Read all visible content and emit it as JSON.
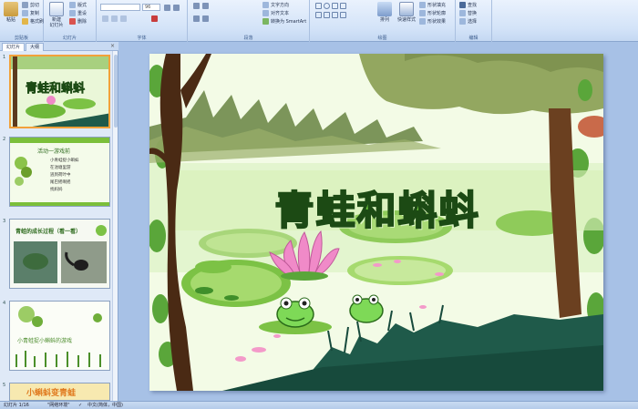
{
  "ribbon": {
    "clipboard": {
      "label": "剪贴板",
      "paste": "粘贴",
      "cut": "剪切",
      "copy": "复制",
      "format_painter": "格式刷"
    },
    "slides": {
      "label": "幻灯片",
      "new_slide": "新建\n幻灯片",
      "layout": "版式",
      "reset": "重设",
      "delete": "删除"
    },
    "font": {
      "label": "字体",
      "font_size": "96"
    },
    "paragraph": {
      "label": "段落",
      "text_direction": "文字方向",
      "align_text": "对齐文本",
      "smartart": "转换为 SmartArt"
    },
    "drawing": {
      "label": "绘图",
      "arrange": "排列",
      "quick_styles": "快速样式",
      "shape_fill": "形状填充",
      "shape_outline": "形状轮廓",
      "shape_effects": "形状效果"
    },
    "editing": {
      "label": "编辑",
      "find": "查找",
      "replace": "替换",
      "select": "选择"
    }
  },
  "left_panel": {
    "tabs": [
      "幻灯片",
      "大纲"
    ],
    "close": "×",
    "thumbnails": [
      {
        "number": "1",
        "title": "青蛙和蝌蚪",
        "selected": true
      },
      {
        "number": "2",
        "title": "活动一游戏前",
        "lines": [
          "小青蛙捉小蝌蚪",
          "在池塘里游",
          "逃到荷叶中",
          "尾巴摇啊摇",
          "找妈妈"
        ]
      },
      {
        "number": "3",
        "title": "青蛙的成长过程（看一看）"
      },
      {
        "number": "4",
        "title": "小青蛙捉小蝌蚪的游戏"
      },
      {
        "number": "5",
        "title": "小蝌蚪变青蛙"
      }
    ]
  },
  "slide": {
    "title": "青蛙和蝌蚪"
  },
  "status": {
    "slide_info": "幻灯片 1/16",
    "theme": "\"网络环境\"",
    "language": "中文(简体，中国)"
  },
  "colors": {
    "ribbon": "#d3e3f8",
    "selected_thumb_border": "#f2a13a",
    "title_fill": "#6cc43c",
    "title_outline": "#1c4a14"
  }
}
